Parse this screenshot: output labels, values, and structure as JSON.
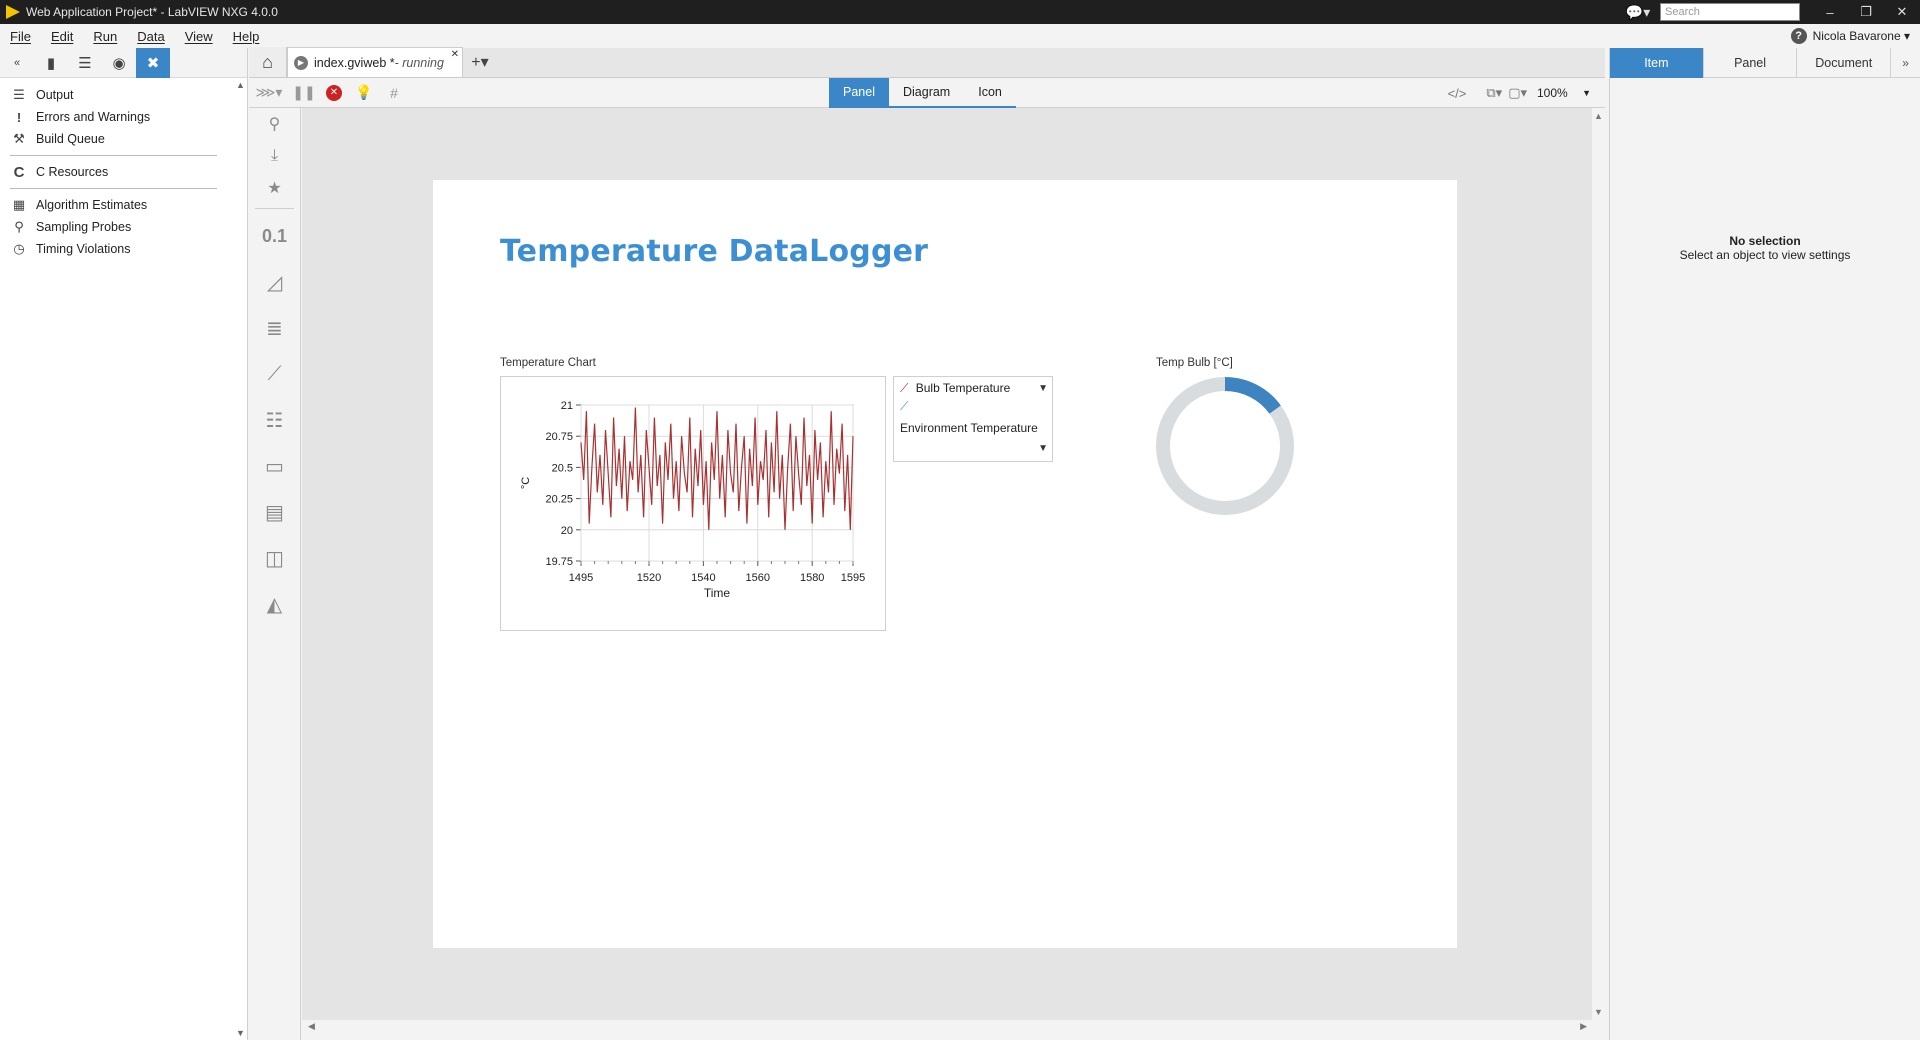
{
  "window": {
    "title": "Web Application Project* - LabVIEW NXG 4.0.0",
    "search_placeholder": "Search",
    "minimize": "–",
    "restore": "❐",
    "close": "✕"
  },
  "menu": {
    "items": [
      "File",
      "Edit",
      "Run",
      "Data",
      "View",
      "Help"
    ],
    "user": "Nicola Bavarone ▾"
  },
  "left_panel": {
    "items": [
      {
        "label": "Output",
        "icon": "list-icon"
      },
      {
        "label": "Errors and Warnings",
        "icon": "exclamation-icon"
      },
      {
        "label": "Build Queue",
        "icon": "hammer-icon"
      },
      {
        "label": "C Resources",
        "icon": "c-icon"
      },
      {
        "label": "Algorithm Estimates",
        "icon": "chip-icon"
      },
      {
        "label": "Sampling Probes",
        "icon": "probe-icon"
      },
      {
        "label": "Timing Violations",
        "icon": "clock-icon"
      }
    ]
  },
  "tabs": {
    "doc_name": "index.gviweb *",
    "doc_status": " - running"
  },
  "view_switch": {
    "panel": "Panel",
    "diagram": "Diagram",
    "icon": "Icon",
    "active": "Panel"
  },
  "toolbar": {
    "zoom": "100%"
  },
  "panel": {
    "title": "Temperature DataLogger",
    "chart_label": "Temperature Chart",
    "legend": {
      "series1": "Bulb Temperature",
      "series2": "Environment Temperature"
    },
    "gauge_label": "Temp Bulb [°C]",
    "gauge_fraction": 0.15
  },
  "chart_data": {
    "type": "line",
    "title": "",
    "xlabel": "Time",
    "ylabel": "°C",
    "xlim": [
      1495,
      1595
    ],
    "ylim": [
      19.75,
      21
    ],
    "x_ticks": [
      1495,
      1520,
      1540,
      1560,
      1580,
      1595
    ],
    "y_ticks": [
      19.75,
      20,
      20.25,
      20.5,
      20.75,
      21
    ],
    "grid": true,
    "series": [
      {
        "name": "Bulb Temperature",
        "color": "#a83232",
        "x_start": 1495,
        "x_step": 1,
        "values": [
          20.7,
          20.4,
          20.95,
          20.05,
          20.5,
          20.85,
          20.3,
          20.6,
          20.2,
          20.8,
          20.45,
          20.1,
          20.9,
          20.35,
          20.65,
          20.25,
          20.75,
          20.15,
          20.55,
          20.4,
          20.98,
          20.3,
          20.6,
          20.1,
          20.8,
          20.5,
          20.2,
          20.9,
          20.35,
          20.6,
          20.05,
          20.7,
          20.4,
          20.85,
          20.25,
          20.55,
          20.15,
          20.75,
          20.45,
          20.3,
          20.9,
          20.1,
          20.65,
          20.35,
          20.8,
          20.2,
          20.55,
          20.0,
          20.7,
          20.4,
          20.95,
          20.25,
          20.6,
          20.1,
          20.8,
          20.45,
          20.3,
          20.85,
          20.15,
          20.5,
          20.75,
          20.05,
          20.65,
          20.35,
          20.9,
          20.2,
          20.55,
          20.4,
          20.8,
          20.1,
          20.7,
          20.3,
          20.95,
          20.25,
          20.6,
          20.0,
          20.5,
          20.85,
          20.15,
          20.75,
          20.45,
          20.2,
          20.9,
          20.35,
          20.6,
          20.05,
          20.8,
          20.4,
          20.7,
          20.1,
          20.55,
          20.3,
          20.95,
          20.2,
          20.65,
          20.45,
          20.85,
          20.15,
          20.6,
          20.0,
          20.75
        ]
      },
      {
        "name": "Environment Temperature",
        "color": "#3b8fd4",
        "values": []
      }
    ]
  },
  "right_panel": {
    "tabs": [
      "Item",
      "Panel",
      "Document"
    ],
    "active_tab": "Item",
    "empty_title": "No selection",
    "empty_subtitle": "Select an object to view settings"
  }
}
